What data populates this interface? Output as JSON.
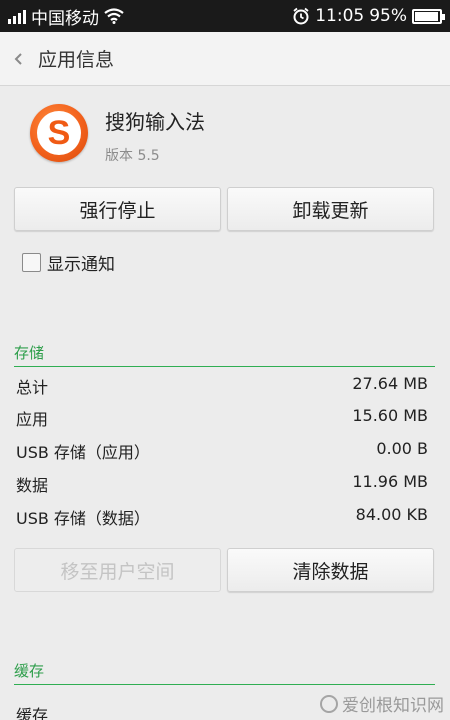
{
  "status_bar": {
    "carrier": "中国移动",
    "time": "11:05",
    "battery_percent": "95%",
    "battery_level": 0.95
  },
  "header": {
    "title": "应用信息",
    "back_icon": "chevron-left"
  },
  "app": {
    "name": "搜狗输入法",
    "version": "版本 5.5",
    "icon_letter": "S",
    "icon_color": "#f2611c"
  },
  "actions": {
    "force_stop": "强行停止",
    "uninstall_updates": "卸载更新"
  },
  "notification": {
    "label": "显示通知",
    "checked": false
  },
  "storage": {
    "title": "存储",
    "rows": [
      {
        "label": "总计",
        "value": "27.64 MB"
      },
      {
        "label": "应用",
        "value": "15.60 MB"
      },
      {
        "label": "USB 存储（应用）",
        "value": "0.00 B"
      },
      {
        "label": "数据",
        "value": "11.96 MB"
      },
      {
        "label": "USB 存储（数据）",
        "value": "84.00 KB"
      }
    ],
    "move_button": "移至用户空间",
    "clear_button": "清除数据"
  },
  "cache": {
    "title": "缓存",
    "rows": [
      {
        "label": "缓存",
        "value": ""
      }
    ]
  },
  "watermark": "爱创根知识网",
  "colors": {
    "accent_green": "#2fae52",
    "status_bar_bg": "#1a1a1a"
  }
}
